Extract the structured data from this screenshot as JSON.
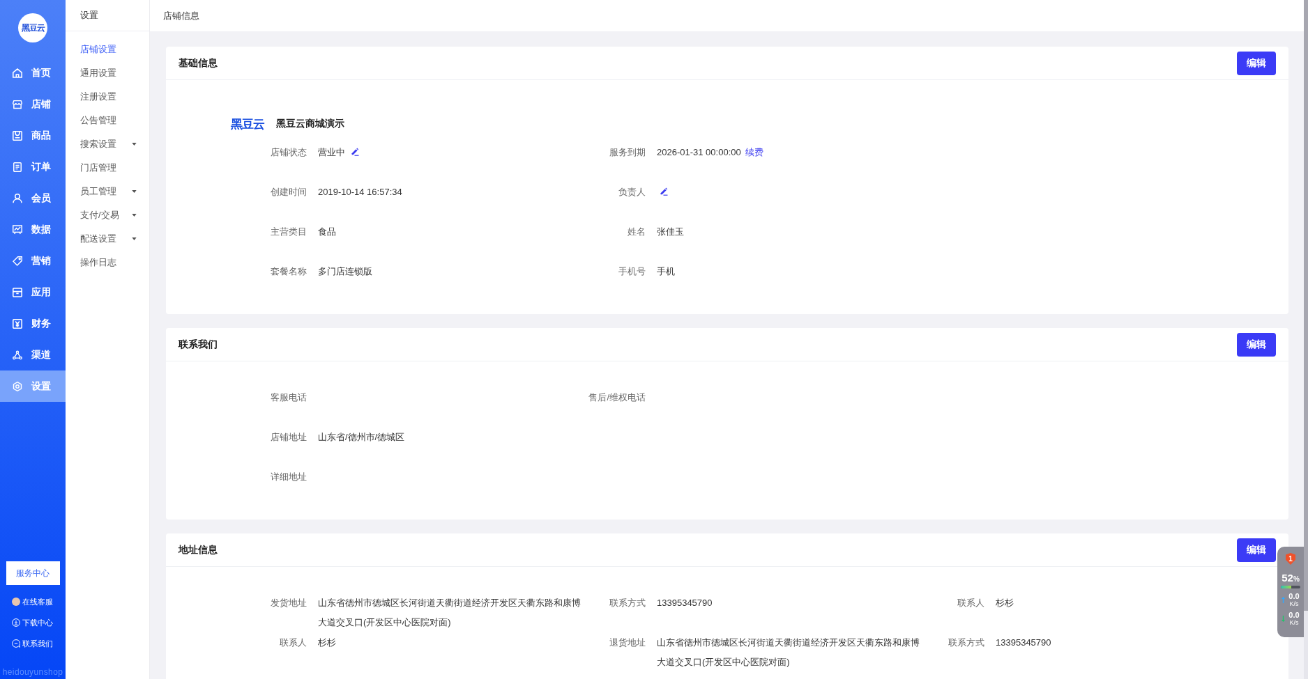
{
  "sidebar": {
    "logo": "黑豆云",
    "items": [
      {
        "label": "首页",
        "selected": false
      },
      {
        "label": "店铺",
        "selected": false
      },
      {
        "label": "商品",
        "selected": false
      },
      {
        "label": "订单",
        "selected": false
      },
      {
        "label": "会员",
        "selected": false
      },
      {
        "label": "数据",
        "selected": false
      },
      {
        "label": "营销",
        "selected": false
      },
      {
        "label": "应用",
        "selected": false
      },
      {
        "label": "财务",
        "selected": false
      },
      {
        "label": "渠道",
        "selected": false
      },
      {
        "label": "设置",
        "selected": true
      }
    ],
    "service_button": "服务中心",
    "links": [
      {
        "label": "在线客服",
        "kind": "avatar"
      },
      {
        "label": "下载中心",
        "kind": "download"
      },
      {
        "label": "联系我们",
        "kind": "chat"
      }
    ],
    "footer": "heidouyunshop"
  },
  "subnav": {
    "title": "设置",
    "items": [
      {
        "label": "店铺设置",
        "kind": "link",
        "selected": true
      },
      {
        "label": "通用设置",
        "kind": "link",
        "selected": false
      },
      {
        "label": "注册设置",
        "kind": "link",
        "selected": false
      },
      {
        "label": "公告管理",
        "kind": "link",
        "selected": false
      },
      {
        "label": "搜索设置",
        "kind": "group",
        "selected": false
      },
      {
        "label": "门店管理",
        "kind": "link",
        "selected": false
      },
      {
        "label": "员工管理",
        "kind": "group",
        "selected": false
      },
      {
        "label": "支付/交易",
        "kind": "group",
        "selected": false
      },
      {
        "label": "配送设置",
        "kind": "group",
        "selected": false
      },
      {
        "label": "操作日志",
        "kind": "link",
        "selected": false
      }
    ]
  },
  "header": {
    "title": "店铺信息"
  },
  "sections": [
    {
      "title": "基础信息",
      "button": "编辑",
      "brand": {
        "logo": "黑豆云",
        "name": "黑豆云商城演示"
      },
      "rows": [
        [
          {
            "label": "店铺状态",
            "value": "营业中",
            "editable": true
          },
          {
            "label": "服务到期",
            "value": "2026-01-31 00:00:00",
            "link": "续费",
            "editable": false
          }
        ],
        [
          {
            "label": "创建时间",
            "value": "2019-10-14 16:57:34",
            "editable": false
          },
          {
            "label": "负责人",
            "editable": true
          }
        ],
        [
          {
            "label": "主营类目",
            "value": "食品",
            "editable": false
          },
          {
            "label": "姓名",
            "value": "张佳玉",
            "editable": false
          }
        ],
        [
          {
            "label": "套餐名称",
            "value": "多门店连锁版",
            "editable": false
          },
          {
            "label": "手机号",
            "value": "手机",
            "editable": false
          }
        ]
      ]
    },
    {
      "title": "联系我们",
      "button": "编辑",
      "rows": [
        [
          {
            "label": "客服电话"
          },
          {
            "label": "售后/维权电话"
          }
        ],
        [
          {
            "label": "店铺地址",
            "value": "山东省/德州市/德城区"
          }
        ],
        [
          {
            "label": "详细地址"
          }
        ]
      ]
    },
    {
      "title": "地址信息",
      "button": "编辑",
      "rows": [
        [
          {
            "label": "发货地址",
            "value": "山东省德州市德城区长河街道天衢街道经济开发区天衢东路和康博大道交叉口(开发区中心医院对面)"
          },
          {
            "label": "联系方式",
            "value": "13395345790"
          },
          {
            "label": "联系人",
            "value": "杉杉"
          }
        ],
        [
          {
            "label": "联系人",
            "value": "杉杉"
          },
          {
            "label": "退货地址",
            "value": "山东省德州市德城区长河街道天衢街道经济开发区天衢东路和康博大道交叉口(开发区中心医院对面)"
          },
          {
            "label": "联系方式",
            "value": "13395345790"
          }
        ]
      ]
    }
  ],
  "monitor": {
    "alerts": "1",
    "usage": "52",
    "usage_unit": "%",
    "level": 0.52,
    "speeds": [
      {
        "kind": "upload",
        "value": "0.0",
        "unit": "K/s"
      },
      {
        "kind": "download",
        "value": "0.0",
        "unit": "K/s"
      }
    ]
  }
}
